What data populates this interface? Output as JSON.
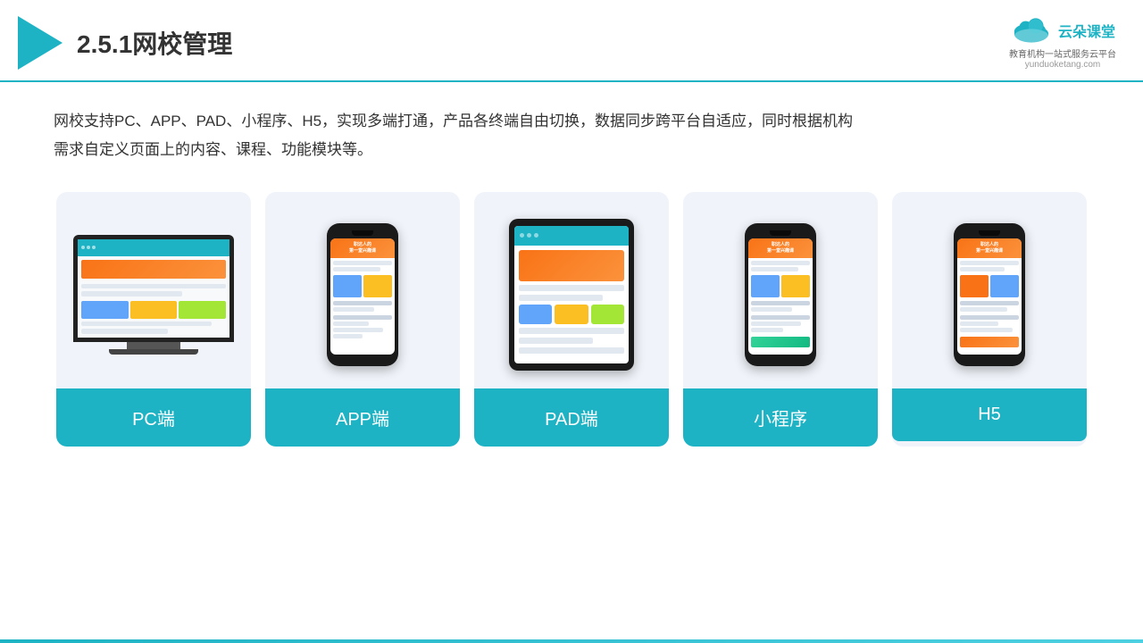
{
  "header": {
    "title": "2.5.1网校管理",
    "brand": {
      "name_cn": "云朵课堂",
      "url": "yunduoketang.com",
      "tagline": "教育机构一站\n式服务云平台"
    }
  },
  "description": "网校支持PC、APP、PAD、小程序、H5，实现多端打通，产品各终端自由切换，数据同步跨平台自适应，同时根据机构\n需求自定义页面上的内容、课程、功能模块等。",
  "devices": [
    {
      "id": "pc",
      "label": "PC端"
    },
    {
      "id": "app",
      "label": "APP端"
    },
    {
      "id": "pad",
      "label": "PAD端"
    },
    {
      "id": "miniapp",
      "label": "小程序"
    },
    {
      "id": "h5",
      "label": "H5"
    }
  ],
  "colors": {
    "accent": "#1db3c4",
    "background": "#f0f4fa",
    "text": "#333333"
  }
}
